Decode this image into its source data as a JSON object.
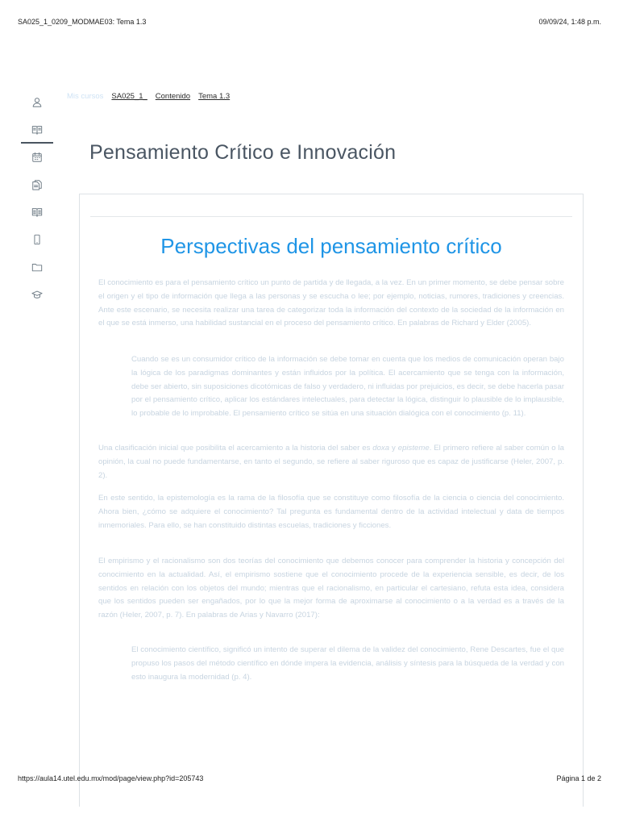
{
  "print_header": {
    "doc_title": "SA025_1_0209_MODMAE03: Tema 1.3",
    "datetime": "09/09/24, 1:48 p.m."
  },
  "print_footer": {
    "url": "https://aula14.utel.edu.mx/mod/page/view.php?id=205743",
    "page_label": "Página 1 de 2"
  },
  "side_nav": {
    "items": [
      {
        "icon": "user-icon",
        "active": false
      },
      {
        "icon": "book-open-icon",
        "active": true
      },
      {
        "icon": "calendar-icon",
        "active": false
      },
      {
        "icon": "documents-icon",
        "active": false
      },
      {
        "icon": "book-icon",
        "active": false
      },
      {
        "icon": "mobile-icon",
        "active": false
      },
      {
        "icon": "folder-icon",
        "active": false
      },
      {
        "icon": "graduation-cap-icon",
        "active": false
      }
    ]
  },
  "breadcrumb": {
    "home": "Mis cursos",
    "items": [
      "SA025_1_",
      "Contenido",
      "Tema 1.3"
    ]
  },
  "course_title": "Pensamiento Crítico e Innovación",
  "content": {
    "heading": "Perspectivas del pensamiento crítico",
    "p1": "El conocimiento es para el pensamiento crítico un punto de partida y de llegada, a la vez. En un primer momento, se debe pensar sobre el origen y el tipo de información que llega a las personas y se escucha o lee; por ejemplo, noticias, rumores, tradiciones y creencias. Ante este escenario, se necesita realizar una tarea de categorizar toda la información del contexto de la sociedad de la información en el que se está inmerso, una habilidad sustancial en el proceso del pensamiento crítico. En palabras de Richard y Elder (2005).",
    "quote1": "Cuando se es un consumidor crítico de la información se debe tomar en cuenta que los medios de comunicación operan bajo la lógica de los paradigmas dominantes y están influidos por la política. El acercamiento que se tenga con la información, debe ser abierto, sin suposiciones dicotómicas de falso y verdadero, ni influidas por prejuicios, es decir, se debe hacerla pasar por el pensamiento crítico, aplicar los estándares intelectuales, para detectar la lógica, distinguir lo plausible de lo implausible, lo probable de lo improbable. El pensamiento crítico se sitúa en una situación dialógica con el conocimiento (p. 11).",
    "p2_a": "Una clasificación inicial que posibilita el acercamiento a la historia del saber es ",
    "p2_doxa": "doxa",
    "p2_y": " y ",
    "p2_episteme": "episteme",
    "p2_b": ". El primero refiere al saber común o la opinión, la cual no puede fundamentarse, en tanto el segundo, se refiere al saber riguroso que es capaz de justificarse (Heler, 2007, p. 2).",
    "p3": "En este sentido, la epistemología es la rama de la filosofía que se constituye como filosofía de la ciencia o ciencia del conocimiento. Ahora bien, ¿cómo se adquiere el conocimiento? Tal pregunta es fundamental dentro de la actividad intelectual y data de tiempos inmemoriales. Para ello, se han constituido distintas escuelas, tradiciones y ficciones.",
    "p4": "El empirismo y el racionalismo son dos teorías del conocimiento que debemos conocer para comprender la historia y concepción del conocimiento en la actualidad. Así, el empirismo sostiene que el conocimiento procede de la experiencia sensible, es decir, de los sentidos en relación con los objetos del mundo; mientras que el racionalismo, en particular el cartesiano, refuta esta idea, considera que los sentidos pueden ser engañados, por lo que la mejor forma de aproximarse al conocimiento o a la verdad es a través de la razón (Heler, 2007, p. 7). En palabras de Arias y Navarro (2017):",
    "quote2": "El conocimiento científico, significó un intento de superar el dilema de la validez del conocimiento, Rene Descartes, fue el que propuso los pasos del método científico en dónde impera la evidencia, análisis y síntesis para la búsqueda de la verdad y con esto inaugura la modernidad (p. 4)."
  }
}
